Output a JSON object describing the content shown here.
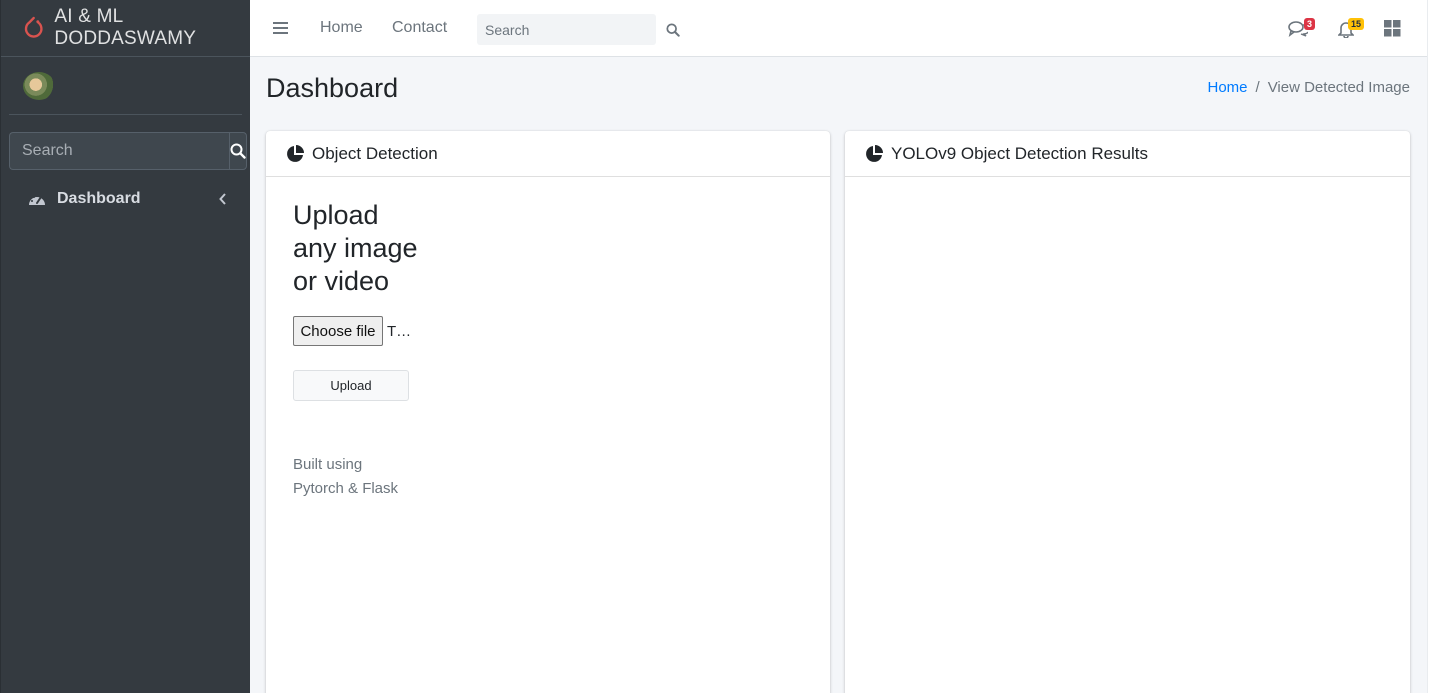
{
  "brand": {
    "name": "AI & ML DODDASWAMY",
    "accent": "#d9534f"
  },
  "sidebar": {
    "search_placeholder": "Search",
    "items": [
      {
        "label": "Dashboard",
        "icon": "tachometer-icon"
      }
    ]
  },
  "topbar": {
    "links": [
      "Home",
      "Contact"
    ],
    "search_placeholder": "Search",
    "messages_count": "3",
    "notifications_count": "15"
  },
  "page": {
    "title": "Dashboard",
    "breadcrumb": {
      "home": "Home",
      "current": "View Detected Image"
    }
  },
  "detection_card": {
    "title": "Object Detection",
    "heading": "Upload any image or video",
    "file_button": "Choose file",
    "file_status": "T…",
    "upload_button": "Upload",
    "footer_note": "Built using Pytorch & Flask"
  },
  "results_card": {
    "title": "YOLOv9 Object Detection Results"
  }
}
